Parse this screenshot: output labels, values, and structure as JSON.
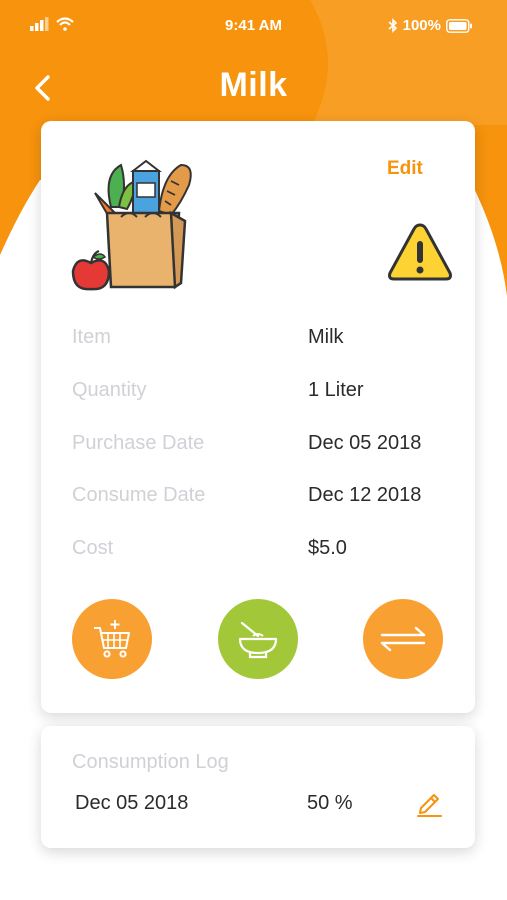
{
  "status_bar": {
    "time": "9:41 AM",
    "battery": "100%",
    "icons": [
      "signal-icon",
      "wifi-icon",
      "bluetooth-icon",
      "battery-icon"
    ]
  },
  "header": {
    "title": "Milk",
    "back_icon": "chevron-left-icon"
  },
  "detail": {
    "edit_label": "Edit",
    "illustration": "grocery-bag-illustration",
    "alert_icon": "warning-icon",
    "rows": [
      {
        "label": "Item",
        "value": "Milk"
      },
      {
        "label": "Quantity",
        "value": "1 Liter"
      },
      {
        "label": "Purchase Date",
        "value": "Dec 05 2018"
      },
      {
        "label": "Consume Date",
        "value": "Dec 12 2018"
      },
      {
        "label": "Cost",
        "value": "$5.0"
      }
    ],
    "actions": [
      "add-to-cart-icon",
      "bowl-icon",
      "transfer-icon"
    ]
  },
  "log": {
    "title": "Consumption Log",
    "entries": [
      {
        "date": "Dec 05 2018",
        "percent": "50 %"
      }
    ],
    "edit_icon": "pencil-icon"
  },
  "colors": {
    "accent": "#f7930d",
    "accent_light": "#f9a032",
    "green": "#a2c83a",
    "label_gray": "#cfd1d6",
    "text_dark": "#2b2b2b",
    "warning_yellow": "#fcd333"
  }
}
